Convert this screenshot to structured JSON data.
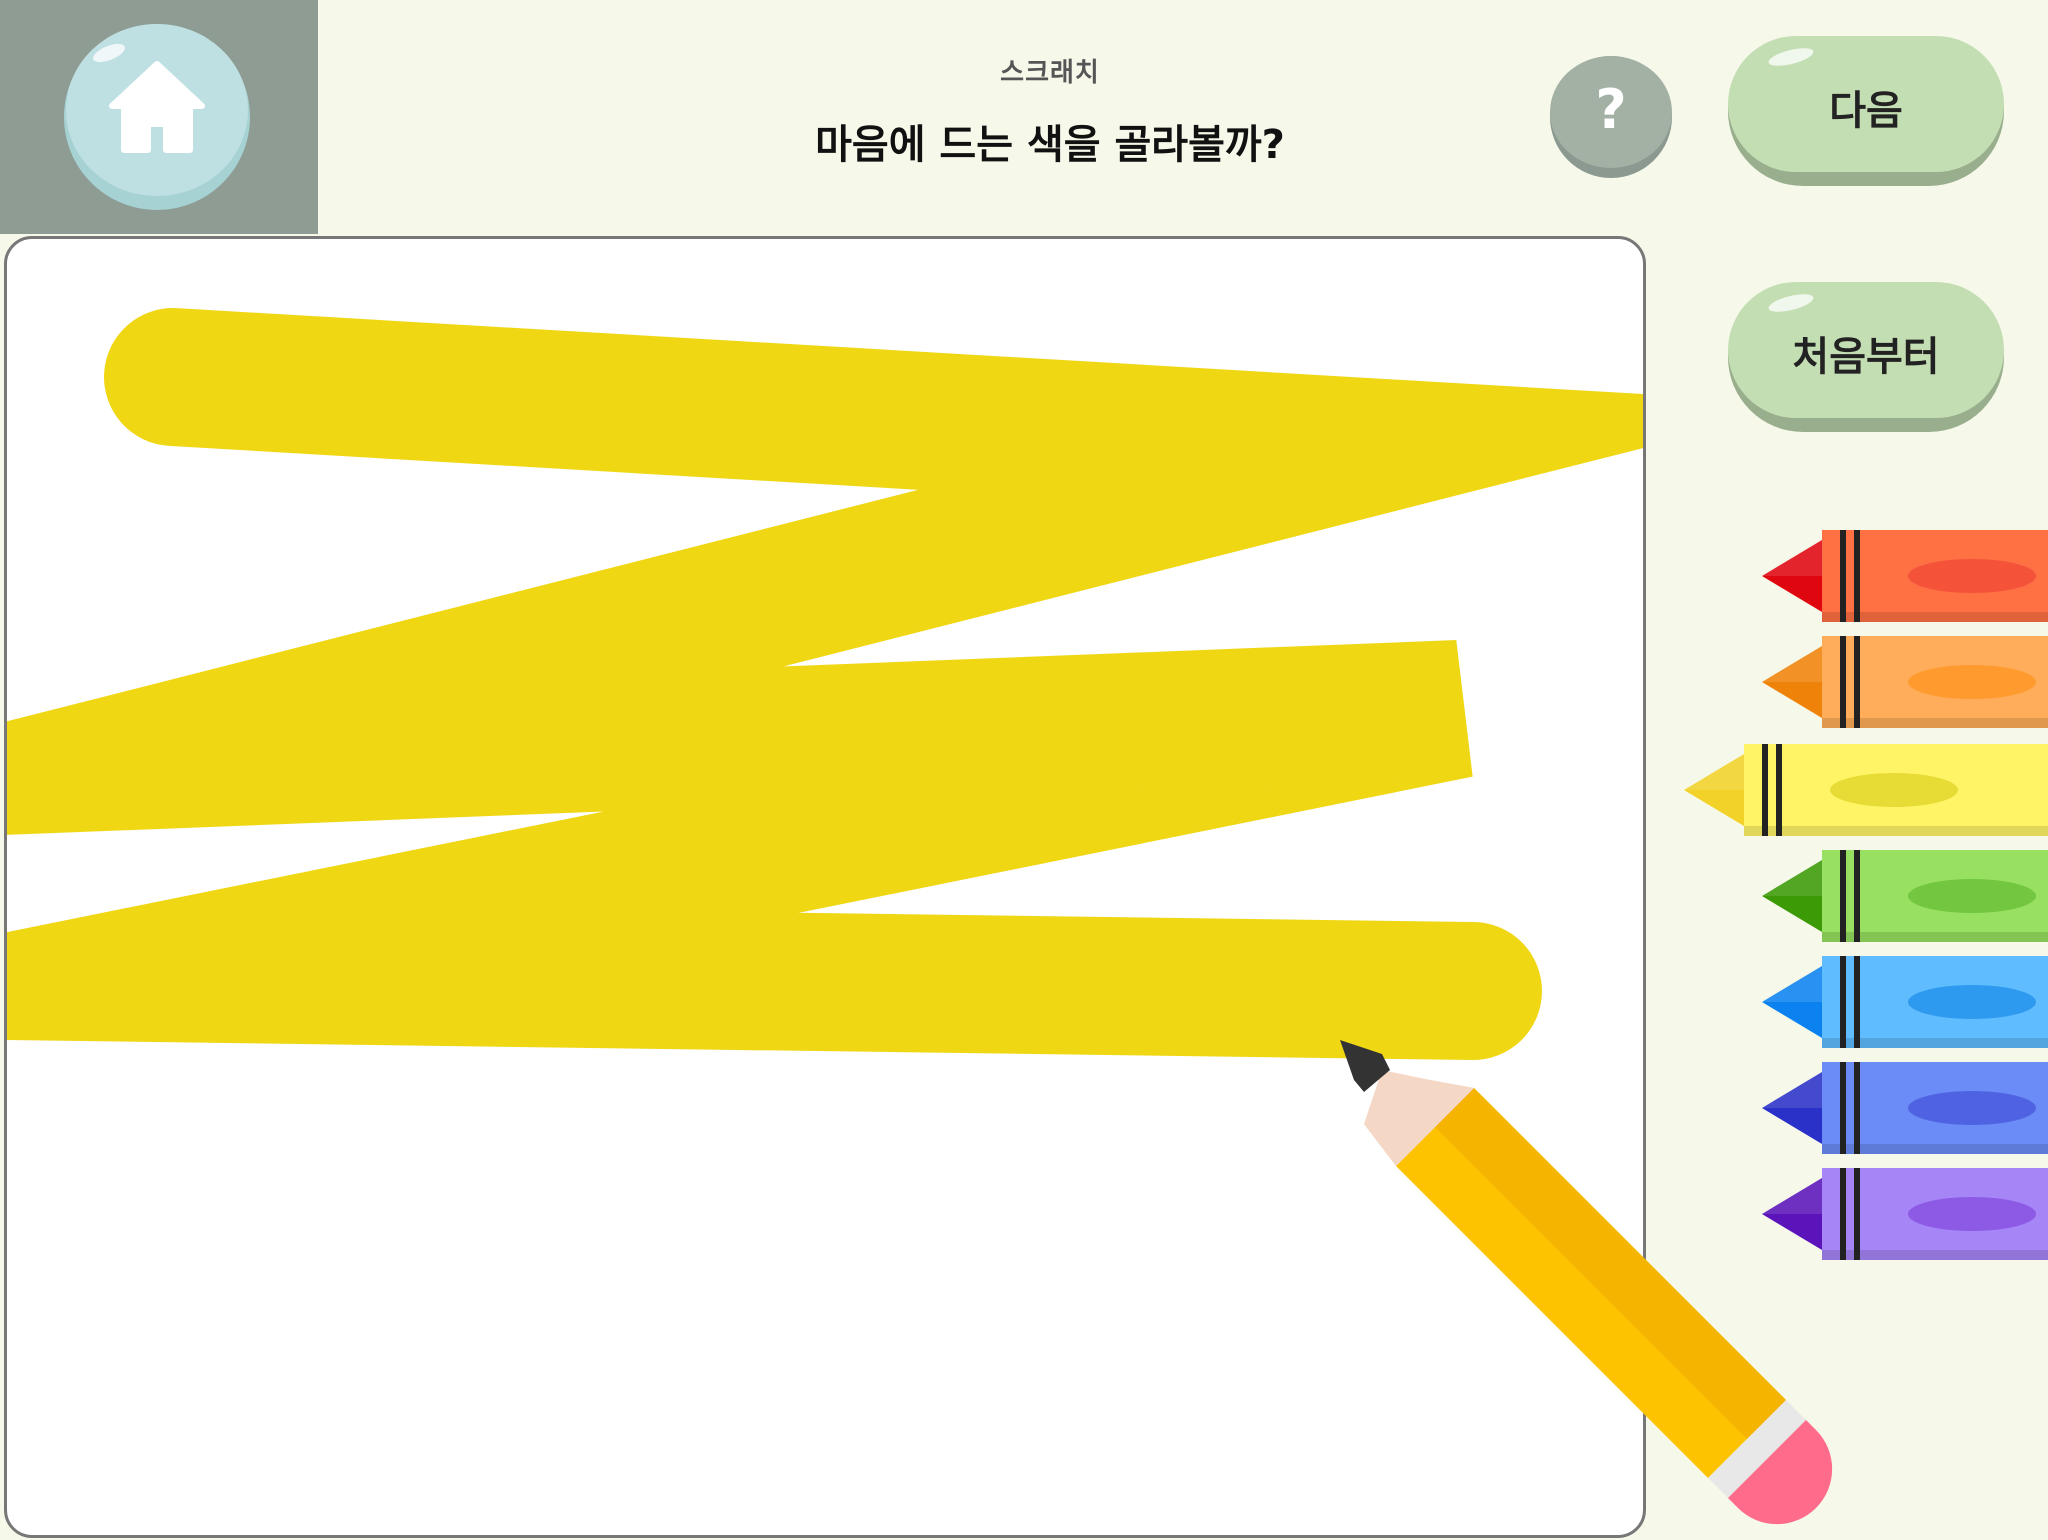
{
  "header": {
    "subtitle": "스크래치",
    "title": "마음에 드는 색을 골라볼까?",
    "help_label": "?",
    "next_label": "다음"
  },
  "side": {
    "restart_label": "처음부터"
  },
  "crayons": [
    {
      "name": "red",
      "body": "#ff7043",
      "tip": "#e0060f",
      "oval": "#f4533a",
      "selected": false
    },
    {
      "name": "orange",
      "body": "#ffad5a",
      "tip": "#ef8208",
      "oval": "#ff9a2e",
      "selected": false
    },
    {
      "name": "yellow",
      "body": "#fff466",
      "tip": "#f2d228",
      "oval": "#e6dc35",
      "selected": true
    },
    {
      "name": "green",
      "body": "#97e061",
      "tip": "#3c9a06",
      "oval": "#72c640",
      "selected": false
    },
    {
      "name": "sky-blue",
      "body": "#5fbcff",
      "tip": "#0b82f0",
      "oval": "#2d9aef",
      "selected": false
    },
    {
      "name": "blue",
      "body": "#6b8cf6",
      "tip": "#2a31c8",
      "oval": "#4f63e2",
      "selected": false
    },
    {
      "name": "purple",
      "body": "#a685f6",
      "tip": "#5a14b9",
      "oval": "#8c5ae4",
      "selected": false
    }
  ],
  "drawing": {
    "stroke_color": "#f0d714"
  },
  "colors": {
    "background": "#f6f9ea",
    "corner": "#8e9c94",
    "home_button": "#bfe0e2",
    "pill_button": "#c4deb4",
    "pencil_body": "#fdc300",
    "pencil_eraser": "#ff6b8a"
  }
}
